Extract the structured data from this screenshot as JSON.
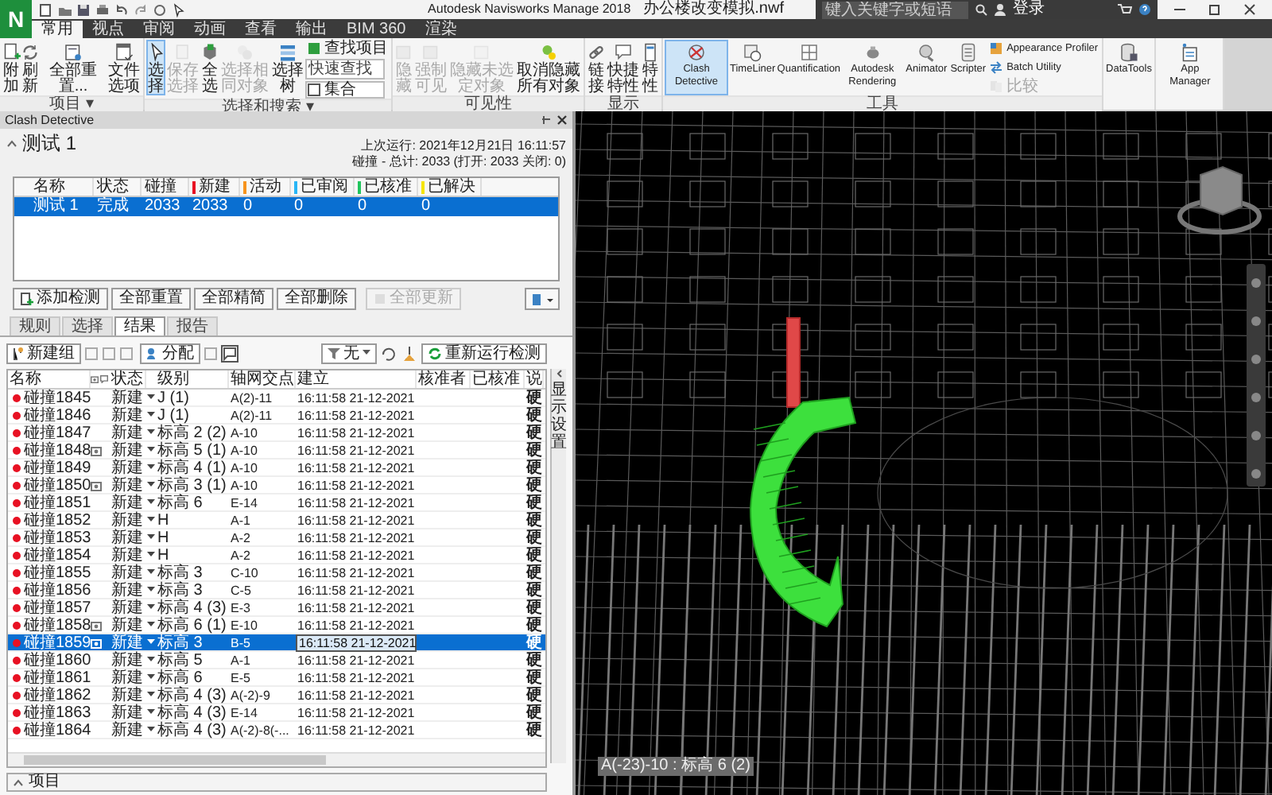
{
  "title_bar": {
    "app_letter": "N",
    "title": "Autodesk Navisworks Manage 2018",
    "file": "办公楼改变模拟.nwf",
    "search": {
      "placeholder": "键入关键字或短语"
    },
    "sign_in": "登录"
  },
  "ribbon": {
    "tabs": [
      {
        "label": "常用",
        "selected": true
      },
      {
        "label": "视点",
        "selected": false
      },
      {
        "label": "审阅",
        "selected": false
      },
      {
        "label": "动画",
        "selected": false
      },
      {
        "label": "查看",
        "selected": false
      },
      {
        "label": "输出",
        "selected": false
      },
      {
        "label": "BIM 360",
        "selected": false
      },
      {
        "label": "渲染",
        "selected": false
      }
    ],
    "groups": [
      {
        "label": "项目 ▾",
        "items": [
          {
            "kind": "large",
            "label": "附加",
            "on": false,
            "disabled": false
          },
          {
            "kind": "large",
            "label": "刷新",
            "on": false,
            "disabled": false
          },
          {
            "kind": "large",
            "label": "全部重置...",
            "on": false,
            "disabled": false
          },
          {
            "kind": "large",
            "label": "文件选项",
            "on": false,
            "disabled": false
          }
        ]
      },
      {
        "label": "选择和搜索 ▾",
        "items": [
          {
            "kind": "large",
            "label": "选择",
            "on": true,
            "disabled": false
          },
          {
            "kind": "large",
            "label": "保存选择",
            "on": false,
            "disabled": true
          },
          {
            "kind": "large",
            "label": "全选",
            "on": false,
            "disabled": false
          },
          {
            "kind": "large",
            "label": "选择相同对象",
            "on": false,
            "disabled": true
          },
          {
            "kind": "large",
            "label": "选择树",
            "on": false,
            "disabled": false
          },
          {
            "kind": "small",
            "label": "查找项目",
            "on": false,
            "disabled": false
          },
          {
            "kind": "field",
            "placeholder": "快速查找"
          },
          {
            "kind": "dropdown",
            "label": "集合"
          }
        ]
      },
      {
        "label": "可见性",
        "items": [
          {
            "kind": "large",
            "label": "隐藏",
            "on": false,
            "disabled": true
          },
          {
            "kind": "large",
            "label": "强制可见",
            "on": false,
            "disabled": true
          },
          {
            "kind": "large",
            "label": "隐藏未选定对象",
            "on": false,
            "disabled": true
          },
          {
            "kind": "large",
            "label": "取消隐藏所有对象",
            "on": false,
            "disabled": false
          }
        ]
      },
      {
        "label": "显示",
        "items": [
          {
            "kind": "large",
            "label": "链接",
            "on": false,
            "disabled": false
          },
          {
            "kind": "large",
            "label": "快捷特性",
            "on": false,
            "disabled": false
          },
          {
            "kind": "large",
            "label": "特性",
            "on": false,
            "disabled": false
          }
        ]
      },
      {
        "label": "工具",
        "items": [
          {
            "kind": "large",
            "label": "Clash Detective",
            "on": true,
            "disabled": false
          },
          {
            "kind": "large",
            "label": "TimeLiner",
            "on": false,
            "disabled": false
          },
          {
            "kind": "large",
            "label": "Quantification",
            "on": false,
            "disabled": false
          },
          {
            "kind": "large",
            "label": "Autodesk Rendering",
            "on": false,
            "disabled": false
          },
          {
            "kind": "large",
            "label": "Animator",
            "on": false,
            "disabled": false
          },
          {
            "kind": "large",
            "label": "Scripter",
            "on": false,
            "disabled": false
          },
          {
            "kind": "small",
            "label": "Appearance Profiler",
            "on": false,
            "disabled": false
          },
          {
            "kind": "small",
            "label": "Batch Utility",
            "on": false,
            "disabled": false
          },
          {
            "kind": "small",
            "label": "比较",
            "on": false,
            "disabled": true
          }
        ]
      },
      {
        "items": [
          {
            "kind": "large",
            "label": "DataTools",
            "on": false,
            "disabled": false
          }
        ]
      },
      {
        "items": [
          {
            "kind": "large",
            "label": "App Manager",
            "on": false,
            "disabled": false
          }
        ]
      }
    ]
  },
  "clash_detective": {
    "title": "Clash Detective",
    "test_name": "测试 1",
    "last_run": "上次运行: 2021年12月21日 16:11:57",
    "summary": "碰撞 - 总计: 2033 (打开: 2033 关闭: 0)",
    "tests_table": {
      "columns": [
        {
          "label": "名称"
        },
        {
          "label": "状态"
        },
        {
          "label": "碰撞"
        },
        {
          "label": "新建",
          "color": "#e81123"
        },
        {
          "label": "活动",
          "color": "#f7941d"
        },
        {
          "label": "已审阅",
          "color": "#29b6f6"
        },
        {
          "label": "已核准",
          "color": "#22c55e"
        },
        {
          "label": "已解决",
          "color": "#f5e400"
        }
      ],
      "rows": [
        {
          "cells": [
            "测试 1",
            "完成",
            "2033",
            "2033",
            "0",
            "0",
            "0",
            "0"
          ],
          "selected": true
        }
      ]
    },
    "test_buttons": [
      {
        "label": "添加检测",
        "disabled": false
      },
      {
        "label": "全部重置",
        "disabled": false
      },
      {
        "label": "全部精简",
        "disabled": false
      },
      {
        "label": "全部删除",
        "disabled": false
      },
      {
        "label": "全部更新",
        "disabled": true
      }
    ],
    "tabs": [
      {
        "label": "规则",
        "selected": false
      },
      {
        "label": "选择",
        "selected": false
      },
      {
        "label": "结果",
        "selected": true
      },
      {
        "label": "报告",
        "selected": false
      }
    ],
    "toolbar": {
      "new_group": "新建组",
      "assign": "分配",
      "filter": "无",
      "rerun": "重新运行检测"
    },
    "results": {
      "columns": [
        "名称",
        "状态",
        "级别",
        "轴网交点",
        "建立",
        "核准者",
        "已核准",
        "说"
      ],
      "rows": [
        {
          "name": "碰撞1845",
          "color": "#e81123",
          "camera": false,
          "status": "新建",
          "level": "J (1)",
          "grid": "A(2)-11",
          "created": "16:11:58 21-12-2021",
          "column_9": "硬",
          "selected": false
        },
        {
          "name": "碰撞1846",
          "color": "#e81123",
          "camera": false,
          "status": "新建",
          "level": "J (1)",
          "grid": "A(2)-11",
          "created": "16:11:58 21-12-2021",
          "column_9": "硬",
          "selected": false
        },
        {
          "name": "碰撞1847",
          "color": "#e81123",
          "camera": false,
          "status": "新建",
          "level": "标高 2 (2)",
          "grid": "A-10",
          "created": "16:11:58 21-12-2021",
          "column_9": "硬",
          "selected": false
        },
        {
          "name": "碰撞1848",
          "color": "#e81123",
          "camera": true,
          "status": "新建",
          "level": "标高 5 (1)",
          "grid": "A-10",
          "created": "16:11:58 21-12-2021",
          "column_9": "硬",
          "selected": false
        },
        {
          "name": "碰撞1849",
          "color": "#e81123",
          "camera": false,
          "status": "新建",
          "level": "标高 4 (1)",
          "grid": "A-10",
          "created": "16:11:58 21-12-2021",
          "column_9": "硬",
          "selected": false
        },
        {
          "name": "碰撞1850",
          "color": "#e81123",
          "camera": true,
          "status": "新建",
          "level": "标高 3 (1)",
          "grid": "A-10",
          "created": "16:11:58 21-12-2021",
          "column_9": "硬",
          "selected": false
        },
        {
          "name": "碰撞1851",
          "color": "#e81123",
          "camera": false,
          "status": "新建",
          "level": "标高 6",
          "grid": "E-14",
          "created": "16:11:58 21-12-2021",
          "column_9": "硬",
          "selected": false
        },
        {
          "name": "碰撞1852",
          "color": "#e81123",
          "camera": false,
          "status": "新建",
          "level": "H",
          "grid": "A-1",
          "created": "16:11:58 21-12-2021",
          "column_9": "硬",
          "selected": false
        },
        {
          "name": "碰撞1853",
          "color": "#e81123",
          "camera": false,
          "status": "新建",
          "level": "H",
          "grid": "A-2",
          "created": "16:11:58 21-12-2021",
          "column_9": "硬",
          "selected": false
        },
        {
          "name": "碰撞1854",
          "color": "#e81123",
          "camera": false,
          "status": "新建",
          "level": "H",
          "grid": "A-2",
          "created": "16:11:58 21-12-2021",
          "column_9": "硬",
          "selected": false
        },
        {
          "name": "碰撞1855",
          "color": "#e81123",
          "camera": false,
          "status": "新建",
          "level": "标高 3",
          "grid": "C-10",
          "created": "16:11:58 21-12-2021",
          "column_9": "硬",
          "selected": false
        },
        {
          "name": "碰撞1856",
          "color": "#e81123",
          "camera": false,
          "status": "新建",
          "level": "标高 3",
          "grid": "C-5",
          "created": "16:11:58 21-12-2021",
          "column_9": "硬",
          "selected": false
        },
        {
          "name": "碰撞1857",
          "color": "#e81123",
          "camera": false,
          "status": "新建",
          "level": "标高 4 (3)",
          "grid": "E-3",
          "created": "16:11:58 21-12-2021",
          "column_9": "硬",
          "selected": false
        },
        {
          "name": "碰撞1858",
          "color": "#e81123",
          "camera": true,
          "status": "新建",
          "level": "标高 6 (1)",
          "grid": "E-10",
          "created": "16:11:58 21-12-2021",
          "column_9": "硬",
          "selected": false
        },
        {
          "name": "碰撞1859",
          "color": "#e81123",
          "camera": true,
          "status": "新建",
          "level": "标高 3",
          "grid": "B-5",
          "created": "16:11:58 21-12-2021",
          "column_9": "硬",
          "selected": true
        },
        {
          "name": "碰撞1860",
          "color": "#e81123",
          "camera": false,
          "status": "新建",
          "level": "标高 5",
          "grid": "A-1",
          "created": "16:11:58 21-12-2021",
          "column_9": "硬",
          "selected": false
        },
        {
          "name": "碰撞1861",
          "color": "#e81123",
          "camera": false,
          "status": "新建",
          "level": "标高 6",
          "grid": "E-5",
          "created": "16:11:58 21-12-2021",
          "column_9": "硬",
          "selected": false
        },
        {
          "name": "碰撞1862",
          "color": "#e81123",
          "camera": false,
          "status": "新建",
          "level": "标高 4 (3)",
          "grid": "A(-2)-9",
          "created": "16:11:58 21-12-2021",
          "column_9": "硬",
          "selected": false
        },
        {
          "name": "碰撞1863",
          "color": "#e81123",
          "camera": false,
          "status": "新建",
          "level": "标高 4 (3)",
          "grid": "E-14",
          "created": "16:11:58 21-12-2021",
          "column_9": "硬",
          "selected": false
        },
        {
          "name": "碰撞1864",
          "color": "#e81123",
          "camera": false,
          "status": "新建",
          "level": "标高 4 (3)",
          "grid": "A(-2)-8(-...",
          "created": "16:11:58 21-12-2021",
          "column_9": "硬",
          "selected": false
        }
      ]
    },
    "side_panel": "显示设置",
    "items_bar": "项目"
  },
  "viewport": {
    "selection_label": "A(-23)-10 : 标高 6 (2)"
  }
}
